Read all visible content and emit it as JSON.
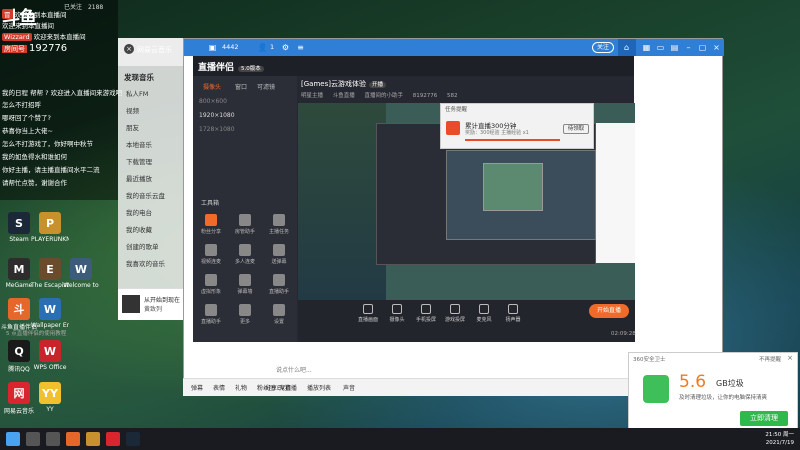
{
  "overlay": {
    "logo": "斗鱼",
    "top_info": [
      "已关注",
      "2188"
    ],
    "score": "192776",
    "score_tag": "房间号",
    "chat": [
      {
        "badge": "冒",
        "user": "",
        "text": "欢迎来到本直播间"
      },
      {
        "badge": "",
        "user": "",
        "text": "欢迎来到本直播间"
      },
      {
        "badge": "Wizzard",
        "user": "",
        "text": "欢迎来到本直播间"
      },
      {
        "badge": "",
        "user": "",
        "text": "我的日程 帮帮 ? 欢迎进入直播间来游戏吧"
      },
      {
        "badge": "",
        "user": "",
        "text": "怎么不打招呼"
      },
      {
        "badge": "",
        "user": "",
        "text": "哪呀回了个赞了?"
      },
      {
        "badge": "",
        "user": "",
        "text": "恭喜你当上大佬~"
      },
      {
        "badge": "",
        "user": "",
        "text": "怎么不打游戏了，你好啊中秋节"
      },
      {
        "badge": "",
        "user": "",
        "text": "我的如鱼得水和谁如何"
      },
      {
        "badge": "",
        "user": "",
        "text": "你好主播，请主播直播间水平二流"
      },
      {
        "badge": "",
        "user": "",
        "text": "请帮忙点赞，谢谢合作"
      }
    ]
  },
  "desktop_icons": [
    {
      "label": "Steam",
      "color": "#1b2838",
      "glyph": "S"
    },
    {
      "label": "PLAYERUNKNOWN'S BATTLEGROUNDS",
      "color": "#c7912d",
      "glyph": "P"
    },
    {
      "label": "MeGame",
      "color": "#2d2d2d",
      "glyph": "M"
    },
    {
      "label": "The Escapists 2",
      "color": "#6a4b2b",
      "glyph": "E"
    },
    {
      "label": "Welcome to",
      "color": "#3d5c7a",
      "glyph": "W"
    },
    {
      "label": "斗鱼直播伴侣",
      "color": "#e6672a",
      "glyph": "斗"
    },
    {
      "label": "Wallpaper Engine",
      "color": "#2a6fb3",
      "glyph": "W"
    },
    {
      "label": "腾讯QQ",
      "color": "#1a1a1a",
      "glyph": "Q"
    },
    {
      "label": "WPS Office",
      "color": "#c8242b",
      "glyph": "W"
    },
    {
      "label": "网易云音乐",
      "color": "#d9262e",
      "glyph": "网"
    },
    {
      "label": "YY",
      "color": "#f0c02f",
      "glyph": "YY"
    }
  ],
  "music": {
    "window_title": "网易云音乐",
    "section": "发现音乐",
    "items": [
      "私人FM",
      "视频",
      "朋友",
      "本地音乐",
      "下载管理",
      "最近播放",
      "我的音乐云盘",
      "我的电台",
      "我的收藏",
      "创建的歌单",
      "我喜欢的音乐"
    ],
    "footer_title": "从开始到现在",
    "footer_artist": "黄致列"
  },
  "stream_window": {
    "room_number": "4442",
    "counter": "1",
    "follow_label": "关注",
    "room_title": "[Games]云游戏体验",
    "room_tag": "开播",
    "room_meta": [
      "明星主播",
      "斗鱼直播",
      "直播间的小助手",
      "8192776",
      "582"
    ],
    "assistant_name": "直播伴侣",
    "assistant_version": "5.0版本",
    "assistant_tabs": [
      "摄像头",
      "窗口",
      "可滤镜"
    ],
    "scenes": [
      "800×600",
      "1920×1080",
      "1728×1080"
    ],
    "tools_label": "工具箱",
    "tools": [
      {
        "label": "粉丝分享",
        "color": "#f06b2a"
      },
      {
        "label": "房管助手",
        "color": "#888"
      },
      {
        "label": "主播任务",
        "color": "#888"
      },
      {
        "label": "视频连麦",
        "color": "#888"
      },
      {
        "label": "多人连麦",
        "color": "#888"
      },
      {
        "label": "送弹幕",
        "color": "#888"
      },
      {
        "label": "虚拟形象",
        "color": "#888"
      },
      {
        "label": "弹幕墙",
        "color": "#888"
      },
      {
        "label": "直播助手",
        "color": "#888"
      },
      {
        "label": "直播助手",
        "color": "#888"
      },
      {
        "label": "更多",
        "color": "#888"
      },
      {
        "label": "设置",
        "color": "#888"
      }
    ],
    "bottom_tip": "5 点直播伴侣的使用教程",
    "controls": [
      "直播画面",
      "摄像头",
      "手机投屏",
      "游戏投屏",
      "麦克风",
      "扬声器"
    ],
    "go_live": "开始直播",
    "timer": "02:09:28",
    "notify_header": "任务提醒",
    "notify_title": "累计直播300分钟",
    "notify_sub": "奖励：300经验  主播经验 x1",
    "notify_btn": "待领取",
    "input_placeholder": "说点什么吧...",
    "input_bar": [
      "弹幕",
      "表情",
      "礼物",
      "粉丝团",
      "竞猜",
      "分享EV直播",
      "播放列表",
      "声音"
    ]
  },
  "cleanup": {
    "header": "360安全卫士",
    "no_remind": "不再提醒",
    "size": "5.6",
    "unit": "GB垃圾",
    "desc": "及时清理垃圾，让你的电脑保持清爽",
    "button": "立即清理"
  },
  "taskbar": {
    "time": "21:50 周一",
    "date": "2021/7/19"
  },
  "colors": {
    "accent": "#f06b2a",
    "douyu_blue": "#2f7fd6",
    "clean_green": "#2fb94c"
  }
}
